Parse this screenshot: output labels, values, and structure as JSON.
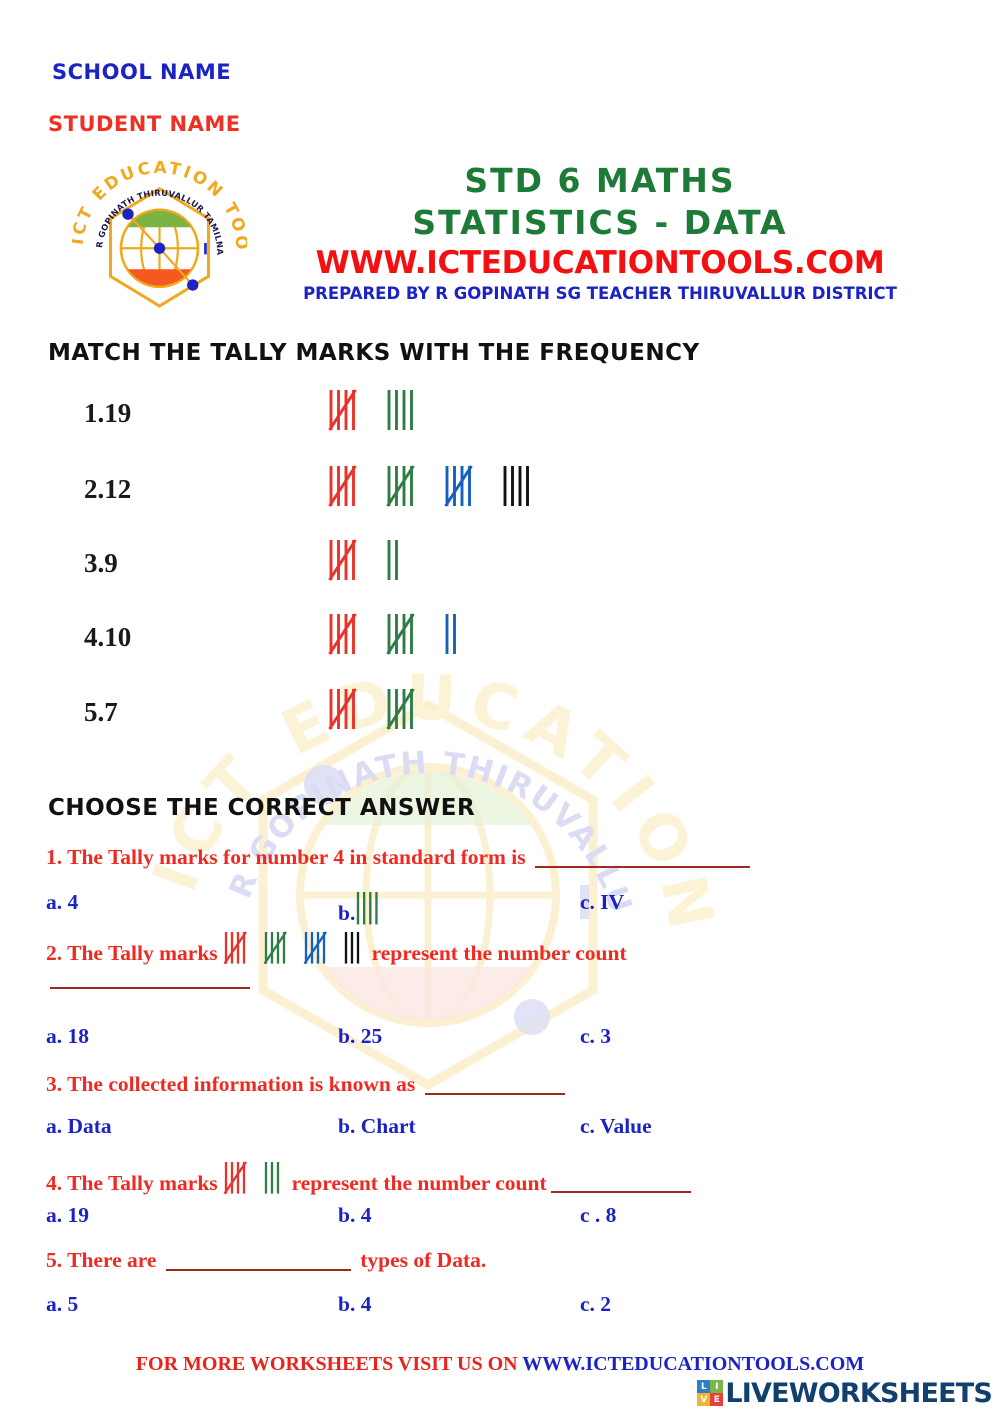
{
  "header": {
    "school_name": "SCHOOL NAME",
    "student_name": "STUDENT NAME",
    "title_line1": "STD 6 MATHS",
    "title_line2": "STATISTICS - DATA",
    "website": "WWW.ICTEDUCATIONTOOLS.COM",
    "prepared_by": "PREPARED BY R GOPINATH SG TEACHER THIRUVALLUR DISTRICT",
    "logo_outer_text": "ICT EDUCATION TOOLS",
    "logo_inner_text": "R GOPINATH THIRUVALLUR TAMILNADU INDIA"
  },
  "watermark": {
    "outer_text": "ICT EDUCATION TOOLS",
    "inner_text": "R GOPINATH THIRUVALLUR TAMILNADU INDIA"
  },
  "sections": {
    "match_heading": "MATCH THE TALLY MARKS WITH THE FREQUENCY",
    "choose_heading": "CHOOSE THE CORRECT ANSWER"
  },
  "match_rows": [
    {
      "label": "1.19",
      "tally_value": 9,
      "groups": [
        {
          "color": "#e8332a",
          "strokes": 5
        },
        {
          "color": "#2f7d44",
          "strokes": 4
        }
      ]
    },
    {
      "label": "2.12",
      "tally_value": 19,
      "groups": [
        {
          "color": "#e8332a",
          "strokes": 5
        },
        {
          "color": "#2f7d44",
          "strokes": 5
        },
        {
          "color": "#1560bd",
          "strokes": 5
        },
        {
          "color": "#121212",
          "strokes": 4
        }
      ]
    },
    {
      "label": "3.9",
      "tally_value": 7,
      "groups": [
        {
          "color": "#e8332a",
          "strokes": 5
        },
        {
          "color": "#2f7d44",
          "strokes": 2
        }
      ]
    },
    {
      "label": "4.10",
      "tally_value": 12,
      "groups": [
        {
          "color": "#e8332a",
          "strokes": 5
        },
        {
          "color": "#2f7d44",
          "strokes": 5
        },
        {
          "color": "#1560bd",
          "strokes": 2
        }
      ]
    },
    {
      "label": "5.7",
      "tally_value": 10,
      "groups": [
        {
          "color": "#e8332a",
          "strokes": 5
        },
        {
          "color": "#2f7d44",
          "strokes": 5
        }
      ]
    }
  ],
  "questions": [
    {
      "number": "1.",
      "text_before": "The Tally marks for number 4 in standard form is",
      "text_after": "",
      "blank_after": true,
      "blank_width": 215,
      "tally_groups": [],
      "options": [
        {
          "key": "a.",
          "label": "a. 4",
          "tally_groups": []
        },
        {
          "key": "b.",
          "label": "b.",
          "tally_groups": [
            {
              "color": "#2f7d44",
              "strokes": 4
            }
          ]
        },
        {
          "key": "c.",
          "label": "c. IV",
          "tally_groups": []
        }
      ]
    },
    {
      "number": "2.",
      "text_before": "The Tally marks",
      "text_after": "represent the number count",
      "blank_after": false,
      "blank_width": 0,
      "wrap_blank_width": 200,
      "tally_groups": [
        {
          "color": "#e8332a",
          "strokes": 5
        },
        {
          "color": "#2f7d44",
          "strokes": 5
        },
        {
          "color": "#1560bd",
          "strokes": 5
        },
        {
          "color": "#121212",
          "strokes": 3
        }
      ],
      "tally_value": 18,
      "options": [
        {
          "key": "a.",
          "label": "a. 18",
          "tally_groups": []
        },
        {
          "key": "b.",
          "label": "b. 25",
          "tally_groups": []
        },
        {
          "key": "c.",
          "label": "c. 3",
          "tally_groups": []
        }
      ]
    },
    {
      "number": "3.",
      "text_before": "The collected information is known as",
      "text_after": "",
      "blank_after": true,
      "blank_width": 140,
      "tally_groups": [],
      "options": [
        {
          "key": "a.",
          "label": "a. Data",
          "tally_groups": []
        },
        {
          "key": "b.",
          "label": "b. Chart",
          "tally_groups": []
        },
        {
          "key": "c.",
          "label": "c. Value",
          "tally_groups": []
        }
      ]
    },
    {
      "number": "4.",
      "text_before": "The Tally marks",
      "text_after": "represent the number count",
      "blank_after": true,
      "blank_width": 140,
      "tally_groups": [
        {
          "color": "#e8332a",
          "strokes": 5
        },
        {
          "color": "#2f7d44",
          "strokes": 3
        }
      ],
      "tally_value": 8,
      "options": [
        {
          "key": "a.",
          "label": "a. 19",
          "tally_groups": []
        },
        {
          "key": "b.",
          "label": "b. 4",
          "tally_groups": []
        },
        {
          "key": "c.",
          "label": "c . 8",
          "tally_groups": []
        }
      ]
    },
    {
      "number": "5.",
      "text_before": "There are",
      "text_after": "types of Data.",
      "blank_after": false,
      "blank_width": 0,
      "inline_blank_width": 185,
      "tally_groups": [],
      "options": [
        {
          "key": "a.",
          "label": "a. 5",
          "tally_groups": []
        },
        {
          "key": "b.",
          "label": "b. 4",
          "tally_groups": []
        },
        {
          "key": "c.",
          "label": "c. 2",
          "tally_groups": []
        }
      ]
    }
  ],
  "question2_wrap_blank": true,
  "footer": {
    "text": "FOR MORE WORKSHEETS VISIT US ON ",
    "url": "WWW.ICTEDUCATIONTOOLS.COM",
    "brand": "LIVEWORKSHEETS",
    "brand_cells": [
      {
        "letter": "L",
        "color": "#2f7ec4"
      },
      {
        "letter": "I",
        "color": "#7ab648"
      },
      {
        "letter": "V",
        "color": "#f2b233"
      },
      {
        "letter": "E",
        "color": "#e8403a"
      }
    ]
  },
  "colors": {
    "blue": "#1b23c4",
    "red": "#ee3124",
    "green": "#1e7a37",
    "tally_red": "#e8332a",
    "tally_green": "#2f7d44",
    "tally_blue": "#1560bd",
    "tally_black": "#121212",
    "blank_line": "#a02a20",
    "logo_gold": "#f0a81e",
    "brand_navy": "#12406e"
  }
}
